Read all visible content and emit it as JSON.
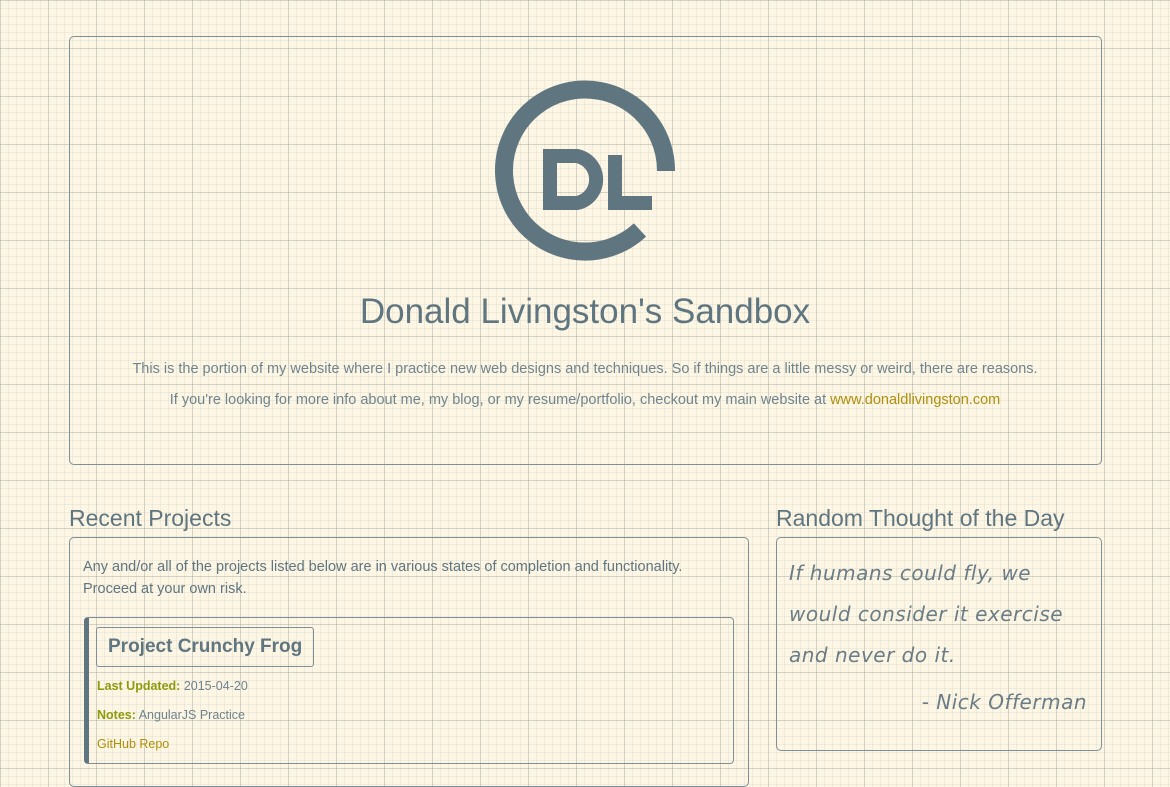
{
  "colors": {
    "background": "#fdf6e4",
    "primary": "#5f7580",
    "link": "#ad8f0c",
    "meta_label": "#8c9a0c"
  },
  "hero": {
    "logo_icon": "dl-monogram-logo",
    "title": "Donald Livingston's Sandbox",
    "intro_line_1": "This is the portion of my website where I practice new web designs and techniques. So if things are a little messy or weird, there are reasons.",
    "intro_line_2_prefix": "If you're looking for more info about me, my blog, or my resume/portfolio, checkout my main website at ",
    "main_site_link": "www.donaldlivingston.com"
  },
  "projects": {
    "heading": "Recent Projects",
    "description": "Any and/or all of the projects listed below are in various states of completion and functionality. Proceed at your own risk.",
    "items": [
      {
        "title": "Project Crunchy Frog",
        "updated_label": "Last Updated:",
        "updated_value": "2015-04-20",
        "notes_label": "Notes:",
        "notes_value": "AngularJS Practice",
        "repo_link": "GitHub Repo"
      }
    ]
  },
  "thought": {
    "heading": "Random Thought of the Day",
    "quote": "If humans could fly, we would consider it exercise and never do it.",
    "author": "- Nick Offerman"
  }
}
